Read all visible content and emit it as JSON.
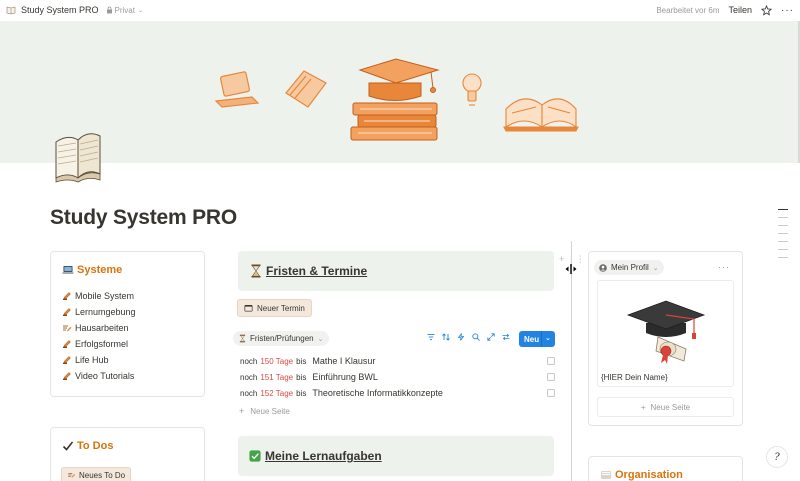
{
  "topbar": {
    "doc_title": "Study System PRO",
    "privacy": "Privat",
    "edited": "Bearbeitet vor 6m",
    "share": "Teilen"
  },
  "page": {
    "title": "Study System PRO"
  },
  "systeme": {
    "heading": "Systeme",
    "items": [
      {
        "label": "Mobile System",
        "icon": "pencil-icon"
      },
      {
        "label": "Lernumgebung",
        "icon": "pencil-icon"
      },
      {
        "label": "Hausarbeiten",
        "icon": "writing-icon"
      },
      {
        "label": "Erfolgsformel",
        "icon": "pencil-icon"
      },
      {
        "label": "Life Hub",
        "icon": "pencil-icon"
      },
      {
        "label": "Video Tutorials",
        "icon": "pencil-icon"
      }
    ]
  },
  "todos": {
    "heading": "To Dos",
    "new_button": "Neues To Do"
  },
  "fristen": {
    "heading": "Fristen & Termine",
    "new_button": "Neuer Termin",
    "view_tab": "Fristen/Prüfungen",
    "new_label": "Neu",
    "rows": [
      {
        "prefix": "noch",
        "days": "150 Tage",
        "suffix": "bis",
        "name": "Mathe I Klausur"
      },
      {
        "prefix": "noch",
        "days": "151 Tage",
        "suffix": "bis",
        "name": "Einführung BWL"
      },
      {
        "prefix": "noch",
        "days": "152 Tage",
        "suffix": "bis",
        "name": "Theoretische Informatikkonzepte"
      }
    ],
    "new_page": "Neue Seite"
  },
  "lernaufgaben": {
    "heading": "Meine Lernaufgaben"
  },
  "profile": {
    "tag": "Mein Profil",
    "name_placeholder": "{HIER Dein Name}",
    "new_page": "Neue Seite"
  },
  "organisation": {
    "heading": "Organisation"
  },
  "help": {
    "label": "?"
  },
  "colors": {
    "accent_orange": "#d9730d",
    "cover_green": "#edf2ec",
    "days_red": "#d44c47",
    "button_blue": "#2383e2"
  }
}
